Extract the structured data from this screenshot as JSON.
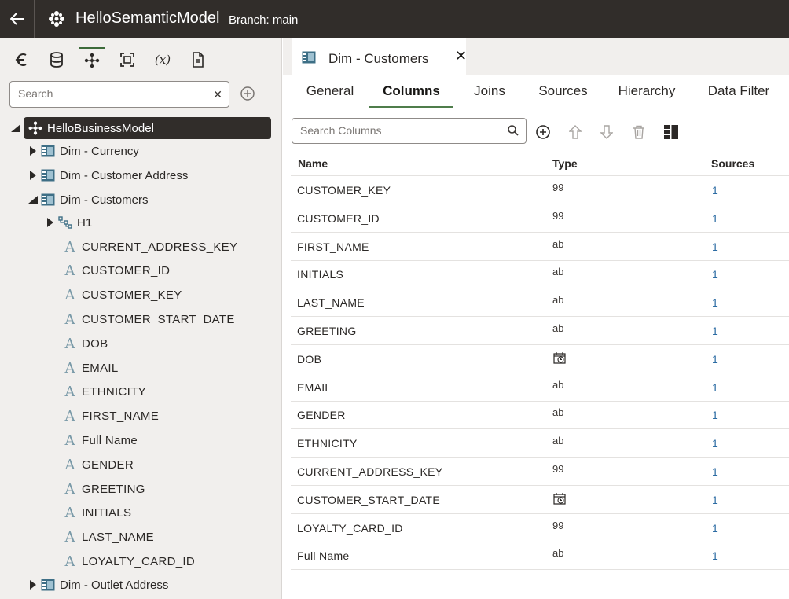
{
  "header": {
    "app_title": "HelloSemanticModel",
    "branch": "Branch: main"
  },
  "left_panel": {
    "toolbar_icons": [
      "back-arrow-icon",
      "database-icon",
      "business-model-icon",
      "physical-layer-icon",
      "variables-icon",
      "document-icon"
    ],
    "search": {
      "placeholder": "Search",
      "value": ""
    },
    "tree": {
      "root": "HelloBusinessModel",
      "tables": [
        {
          "label": "Dim - Currency",
          "expanded": false
        },
        {
          "label": "Dim - Customer Address",
          "expanded": false
        },
        {
          "label": "Dim - Customers",
          "expanded": true
        },
        {
          "label": "Dim - Outlet Address",
          "expanded": false
        }
      ],
      "hierarchy": "H1",
      "columns": [
        "CURRENT_ADDRESS_KEY",
        "CUSTOMER_ID",
        "CUSTOMER_KEY",
        "CUSTOMER_START_DATE",
        "DOB",
        "EMAIL",
        "ETHNICITY",
        "FIRST_NAME",
        "Full Name",
        "GENDER",
        "GREETING",
        "INITIALS",
        "LAST_NAME",
        "LOYALTY_CARD_ID"
      ]
    }
  },
  "editor": {
    "doc_tab": "Dim - Customers",
    "tabs": [
      "General",
      "Columns",
      "Joins",
      "Sources",
      "Hierarchy",
      "Data Filter"
    ],
    "active_tab": "Columns",
    "search": {
      "placeholder": "Search Columns",
      "value": ""
    },
    "table": {
      "headers": {
        "name": "Name",
        "type": "Type",
        "sources": "Sources"
      },
      "rows": [
        {
          "name": "CUSTOMER_KEY",
          "type": "99",
          "sources": "1"
        },
        {
          "name": "CUSTOMER_ID",
          "type": "99",
          "sources": "1"
        },
        {
          "name": "FIRST_NAME",
          "type": "ab",
          "sources": "1"
        },
        {
          "name": "INITIALS",
          "type": "ab",
          "sources": "1"
        },
        {
          "name": "LAST_NAME",
          "type": "ab",
          "sources": "1"
        },
        {
          "name": "GREETING",
          "type": "ab",
          "sources": "1"
        },
        {
          "name": "DOB",
          "type": "date-icon",
          "sources": "1"
        },
        {
          "name": "EMAIL",
          "type": "ab",
          "sources": "1"
        },
        {
          "name": "GENDER",
          "type": "ab",
          "sources": "1"
        },
        {
          "name": "ETHNICITY",
          "type": "ab",
          "sources": "1"
        },
        {
          "name": "CURRENT_ADDRESS_KEY",
          "type": "99",
          "sources": "1"
        },
        {
          "name": "CUSTOMER_START_DATE",
          "type": "date-icon",
          "sources": "1"
        },
        {
          "name": "LOYALTY_CARD_ID",
          "type": "99",
          "sources": "1"
        },
        {
          "name": "Full Name",
          "type": "ab",
          "sources": "1"
        }
      ]
    }
  },
  "colors": {
    "header_bg": "#312d2a",
    "panel_bg": "#f1efed",
    "accent_green": "#4f7d4b",
    "link_blue": "#2b6ba3"
  }
}
